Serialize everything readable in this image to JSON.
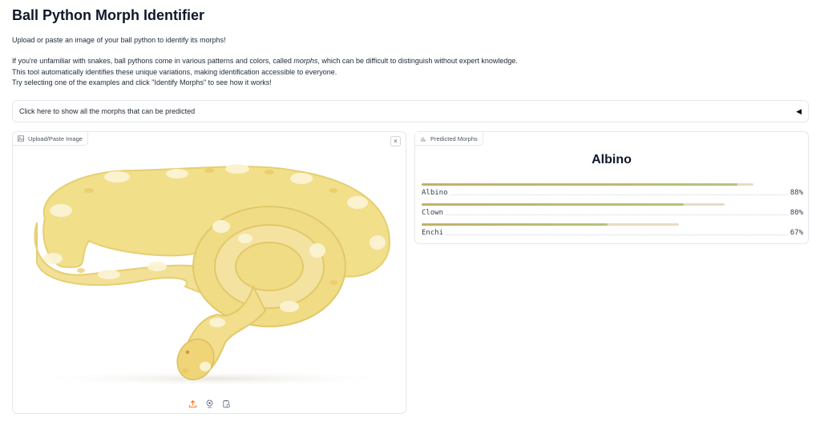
{
  "app": {
    "title": "Ball Python Morph Identifier",
    "intro": "Upload or paste an image of your ball python to identify its morphs!",
    "desc_line1_pre": "If you're unfamiliar with snakes, ball pythons come in various patterns and colors, called ",
    "desc_line1_em": "morphs",
    "desc_line1_post": ", which can be difficult to distinguish without expert knowledge.",
    "desc_line2": "This tool automatically identifies these unique variations, making identification accessible to everyone.",
    "desc_line3": "Try selecting one of the examples and click \"Identify Morphs\" to see how it works!"
  },
  "accordion": {
    "label": "Click here to show all the morphs that can be predicted",
    "arrow": "◀"
  },
  "upload": {
    "label": "Upload/Paste Image",
    "close": "×"
  },
  "prediction": {
    "label": "Predicted Morphs",
    "top": "Albino",
    "confidences": [
      {
        "label": "Albino",
        "value": 0.88,
        "percent": "88%"
      },
      {
        "label": "Clown",
        "value": 0.8,
        "percent": "80%"
      },
      {
        "label": "Enchi",
        "value": 0.67,
        "percent": "67%"
      }
    ]
  },
  "colors": {
    "accent": "#f97316",
    "bar": "#b6c37a",
    "track": "#e8dcc4",
    "snake_base": "#f1df8a",
    "snake_pattern": "#fbf4d4"
  }
}
